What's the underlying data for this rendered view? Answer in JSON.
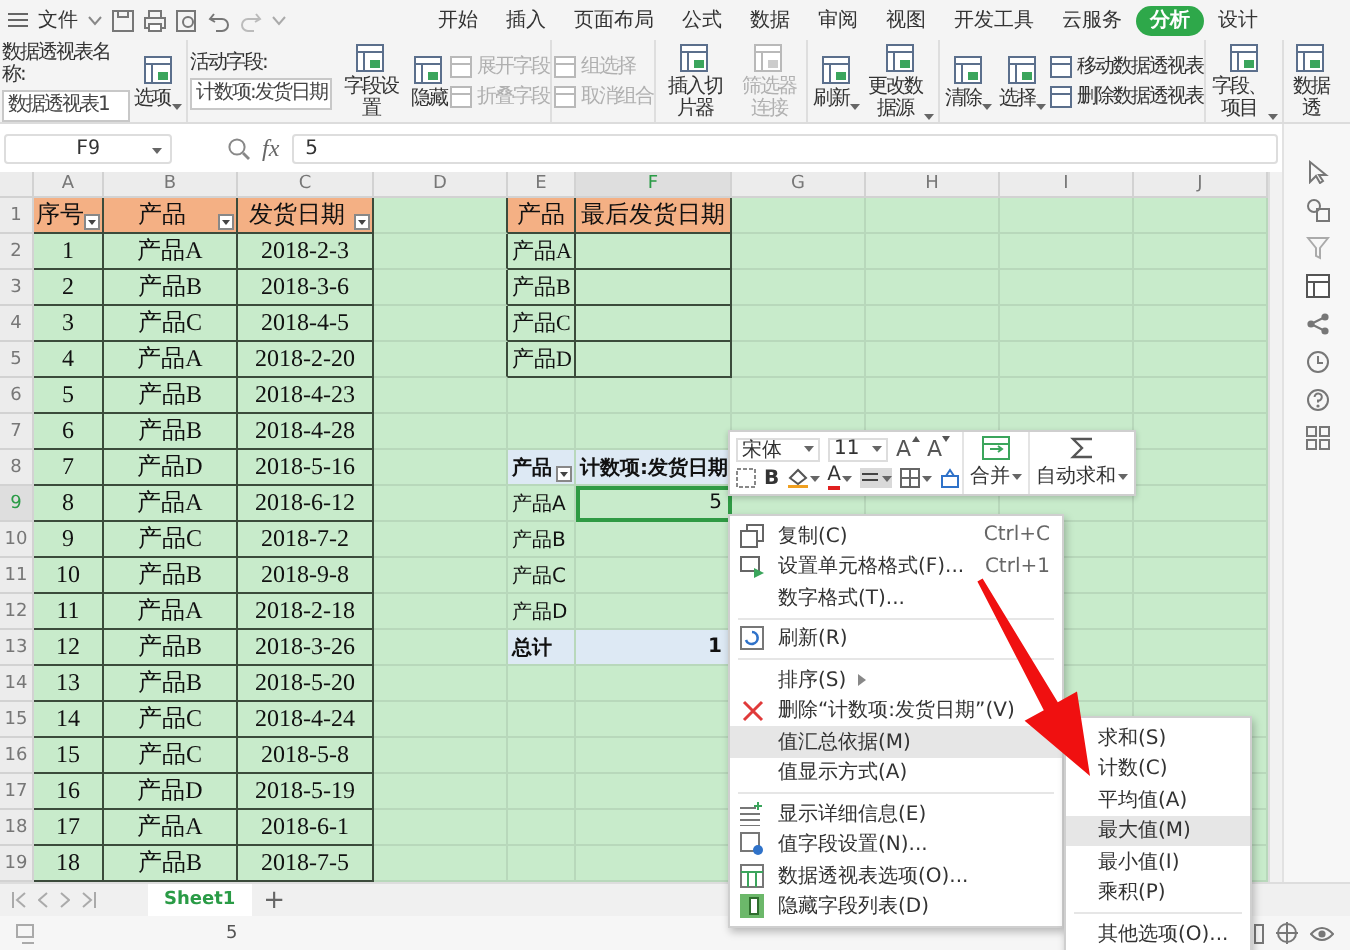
{
  "menu_bar": {
    "file_label": "文件",
    "tabs": [
      {
        "label": "开始",
        "selected": false
      },
      {
        "label": "插入",
        "selected": false
      },
      {
        "label": "页面布局",
        "selected": false
      },
      {
        "label": "公式",
        "selected": false
      },
      {
        "label": "数据",
        "selected": false
      },
      {
        "label": "审阅",
        "selected": false
      },
      {
        "label": "视图",
        "selected": false
      },
      {
        "label": "开发工具",
        "selected": false
      },
      {
        "label": "云服务",
        "selected": false
      },
      {
        "label": "分析",
        "selected": true
      },
      {
        "label": "设计",
        "selected": false
      }
    ]
  },
  "ribbon": {
    "groups": [
      [
        {
          "kind": "field",
          "label": "数据透视表名称:",
          "value": "数据透视表1"
        },
        {
          "kind": "large",
          "label": "选项",
          "dropdown": true,
          "disabled": false
        }
      ],
      [
        {
          "kind": "field",
          "label": "活动字段:",
          "value": "计数项:发货日期"
        },
        {
          "kind": "large",
          "label": "字段设置",
          "dropdown": false,
          "disabled": false
        },
        {
          "kind": "large",
          "label": "隐藏",
          "dropdown": false,
          "disabled": false
        },
        {
          "kind": "stack",
          "items": [
            {
              "label": "展开字段",
              "disabled": true
            },
            {
              "label": "折叠字段",
              "disabled": true
            }
          ]
        }
      ],
      [
        {
          "kind": "stack",
          "items": [
            {
              "label": "组选择",
              "disabled": true
            },
            {
              "label": "取消组合",
              "disabled": true
            }
          ]
        }
      ],
      [
        {
          "kind": "large",
          "label": "插入切片器",
          "dropdown": false,
          "disabled": false
        },
        {
          "kind": "large",
          "label": "筛选器连接",
          "dropdown": false,
          "disabled": true
        }
      ],
      [
        {
          "kind": "large",
          "label": "刷新",
          "dropdown": true,
          "disabled": false
        },
        {
          "kind": "large",
          "label": "更改数据源",
          "dropdown": true,
          "disabled": false
        }
      ],
      [
        {
          "kind": "large",
          "label": "清除",
          "dropdown": true,
          "disabled": false
        },
        {
          "kind": "large",
          "label": "选择",
          "dropdown": true,
          "disabled": false
        },
        {
          "kind": "stack",
          "items": [
            {
              "label": "移动数据透视表",
              "disabled": false
            },
            {
              "label": "删除数据透视表",
              "disabled": false
            }
          ]
        }
      ],
      [
        {
          "kind": "large",
          "label": "字段、项目",
          "dropdown": true,
          "disabled": false
        }
      ],
      [
        {
          "kind": "large",
          "label": "数据透",
          "dropdown": false,
          "disabled": false
        }
      ]
    ]
  },
  "formula_bar": {
    "cell_ref": "F9",
    "fx_label": "fx",
    "value": "5"
  },
  "sheet": {
    "columns": [
      {
        "label": "A",
        "selected": false
      },
      {
        "label": "B",
        "selected": false
      },
      {
        "label": "C",
        "selected": false
      },
      {
        "label": "D",
        "selected": false
      },
      {
        "label": "E",
        "selected": false
      },
      {
        "label": "F",
        "selected": true
      },
      {
        "label": "G",
        "selected": false
      },
      {
        "label": "H",
        "selected": false
      },
      {
        "label": "I",
        "selected": false
      },
      {
        "label": "J",
        "selected": false
      }
    ],
    "rows": [
      {
        "label": "1",
        "selected": false
      },
      {
        "label": "2",
        "selected": false
      },
      {
        "label": "3",
        "selected": false
      },
      {
        "label": "4",
        "selected": false
      },
      {
        "label": "5",
        "selected": false
      },
      {
        "label": "6",
        "selected": false
      },
      {
        "label": "7",
        "selected": false
      },
      {
        "label": "8",
        "selected": false
      },
      {
        "label": "9",
        "selected": true
      },
      {
        "label": "10",
        "selected": false
      },
      {
        "label": "11",
        "selected": false
      },
      {
        "label": "12",
        "selected": false
      },
      {
        "label": "13",
        "selected": false
      },
      {
        "label": "14",
        "selected": false
      },
      {
        "label": "15",
        "selected": false
      },
      {
        "label": "16",
        "selected": false
      },
      {
        "label": "17",
        "selected": false
      },
      {
        "label": "18",
        "selected": false
      },
      {
        "label": "19",
        "selected": false
      }
    ],
    "source_table": {
      "header": [
        "序号",
        "产品",
        "发货日期"
      ],
      "rows": [
        [
          "1",
          "产品A",
          "2018-2-3"
        ],
        [
          "2",
          "产品B",
          "2018-3-6"
        ],
        [
          "3",
          "产品C",
          "2018-4-5"
        ],
        [
          "4",
          "产品A",
          "2018-2-20"
        ],
        [
          "5",
          "产品B",
          "2018-4-23"
        ],
        [
          "6",
          "产品B",
          "2018-4-28"
        ],
        [
          "7",
          "产品D",
          "2018-5-16"
        ],
        [
          "8",
          "产品A",
          "2018-6-12"
        ],
        [
          "9",
          "产品C",
          "2018-7-2"
        ],
        [
          "10",
          "产品B",
          "2018-9-8"
        ],
        [
          "11",
          "产品A",
          "2018-2-18"
        ],
        [
          "12",
          "产品B",
          "2018-3-26"
        ],
        [
          "13",
          "产品B",
          "2018-5-20"
        ],
        [
          "14",
          "产品C",
          "2018-4-24"
        ],
        [
          "15",
          "产品C",
          "2018-5-8"
        ],
        [
          "16",
          "产品D",
          "2018-5-19"
        ],
        [
          "17",
          "产品A",
          "2018-6-1"
        ],
        [
          "18",
          "产品B",
          "2018-7-5"
        ]
      ]
    },
    "lookup_table": {
      "header": [
        "产品",
        "最后发货日期"
      ],
      "rows": [
        "产品A",
        "产品B",
        "产品C",
        "产品D"
      ]
    },
    "pivot": {
      "row_field": "产品",
      "value_field": "计数项:发货日期",
      "items": [
        {
          "label": "产品A",
          "value": "5",
          "selected": true
        },
        {
          "label": "产品B",
          "selected": false
        },
        {
          "label": "产品C",
          "selected": false
        },
        {
          "label": "产品D",
          "selected": false
        }
      ],
      "total_label": "总计",
      "total_value": "1"
    }
  },
  "mini_toolbar": {
    "font": "宋体",
    "size": "11",
    "grow_font": "A",
    "shrink_font": "A",
    "bold": "B",
    "font_color": "A",
    "merge": "合并",
    "autosum": "自动求和"
  },
  "context_menu": {
    "groups": [
      [
        {
          "label": "复制(C)",
          "shortcut": "Ctrl+C",
          "selected": false,
          "has_submenu": false
        },
        {
          "label": "设置单元格格式(F)...",
          "shortcut": "Ctrl+1",
          "selected": false,
          "has_submenu": false
        },
        {
          "label": "数字格式(T)...",
          "selected": false,
          "has_submenu": false
        }
      ],
      [
        {
          "label": "刷新(R)",
          "selected": false,
          "has_submenu": false
        }
      ],
      [
        {
          "label": "排序(S)",
          "selected": false,
          "has_submenu": true
        },
        {
          "label": "删除“计数项:发货日期”(V)",
          "selected": false,
          "has_submenu": false
        },
        {
          "label": "值汇总依据(M)",
          "selected": true,
          "has_submenu": false
        },
        {
          "label": "值显示方式(A)",
          "selected": false,
          "has_submenu": false
        }
      ],
      [
        {
          "label": "显示详细信息(E)",
          "selected": false,
          "has_submenu": false
        },
        {
          "label": "值字段设置(N)...",
          "selected": false,
          "has_submenu": false
        },
        {
          "label": "数据透视表选项(O)...",
          "selected": false,
          "has_submenu": false
        },
        {
          "label": "隐藏字段列表(D)",
          "selected": false,
          "has_submenu": false
        }
      ]
    ]
  },
  "submenu": {
    "groups": [
      [
        {
          "label": "求和(S)",
          "selected": false
        },
        {
          "label": "计数(C)",
          "selected": false
        },
        {
          "label": "平均值(A)",
          "selected": false
        },
        {
          "label": "最大值(M)",
          "selected": true
        },
        {
          "label": "最小值(I)",
          "selected": false
        },
        {
          "label": "乘积(P)",
          "selected": false
        }
      ],
      [
        {
          "label": "其他选项(O)...",
          "selected": false
        }
      ]
    ]
  },
  "sheet_tabs": {
    "tabs": [
      {
        "label": "Sheet1",
        "selected": true
      }
    ],
    "add_label": "+"
  },
  "status_bar": {
    "value": "5"
  }
}
